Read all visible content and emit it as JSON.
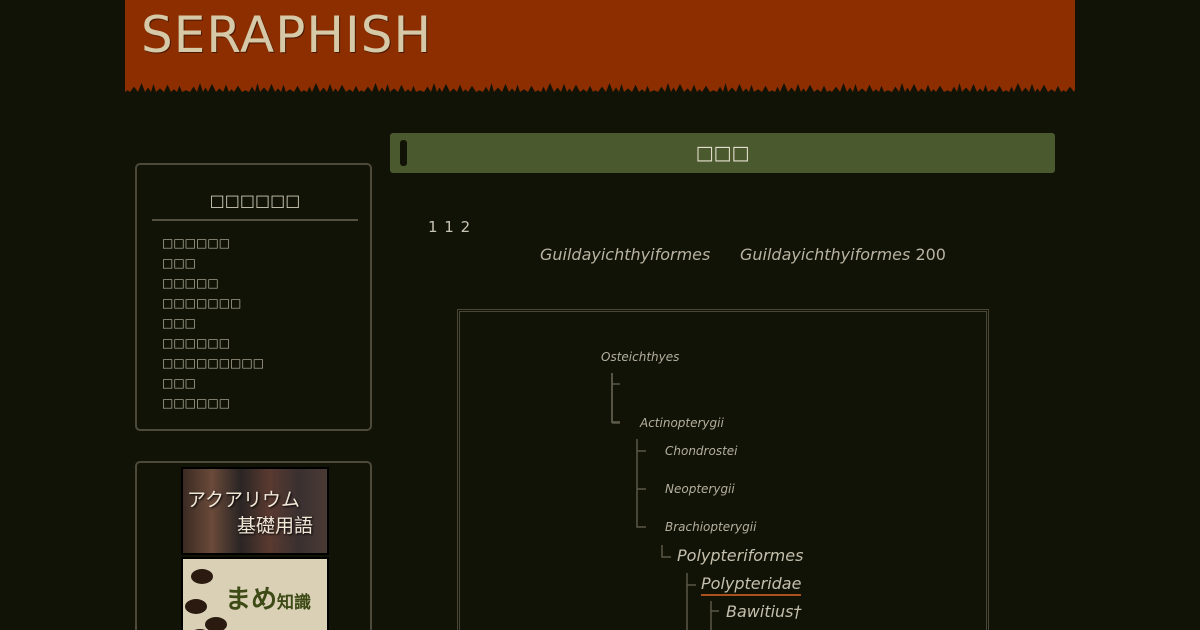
{
  "header": {
    "logo_text": "SERAPHISH",
    "bg_color": "#8c2e00"
  },
  "sidebar": {
    "menu_title": "□□□□□□",
    "items": [
      {
        "label": "□□□□□□"
      },
      {
        "label": "□□□"
      },
      {
        "label": "□□□□□"
      },
      {
        "label": "□□□□□□□"
      },
      {
        "label": "□□□"
      },
      {
        "label": "□□□□□□"
      },
      {
        "label": "□□□□□□□□□"
      },
      {
        "label": "□□□"
      },
      {
        "label": "□□□□□□"
      }
    ],
    "banners": [
      {
        "line1": "アクアリウム",
        "line2": "基礎用語"
      },
      {
        "text": "まめ",
        "small": "知識"
      }
    ]
  },
  "main": {
    "title": "□□□",
    "title_bg": "#4b5a2e",
    "intro": "1 1 2",
    "info_left": "Guildayichthyiformes",
    "info_right": "Guildayichthyiformes",
    "info_number": "200"
  },
  "tree": {
    "nodes": [
      {
        "label": "Osteichthyes"
      },
      {
        "label": "Actinopterygii"
      },
      {
        "label": "Chondrostei"
      },
      {
        "label": "Neopterygii"
      },
      {
        "label": "Brachiopterygii"
      },
      {
        "label": "Polypteriformes"
      },
      {
        "label": "Polypteridae"
      },
      {
        "label": "Bawitius†"
      }
    ]
  }
}
